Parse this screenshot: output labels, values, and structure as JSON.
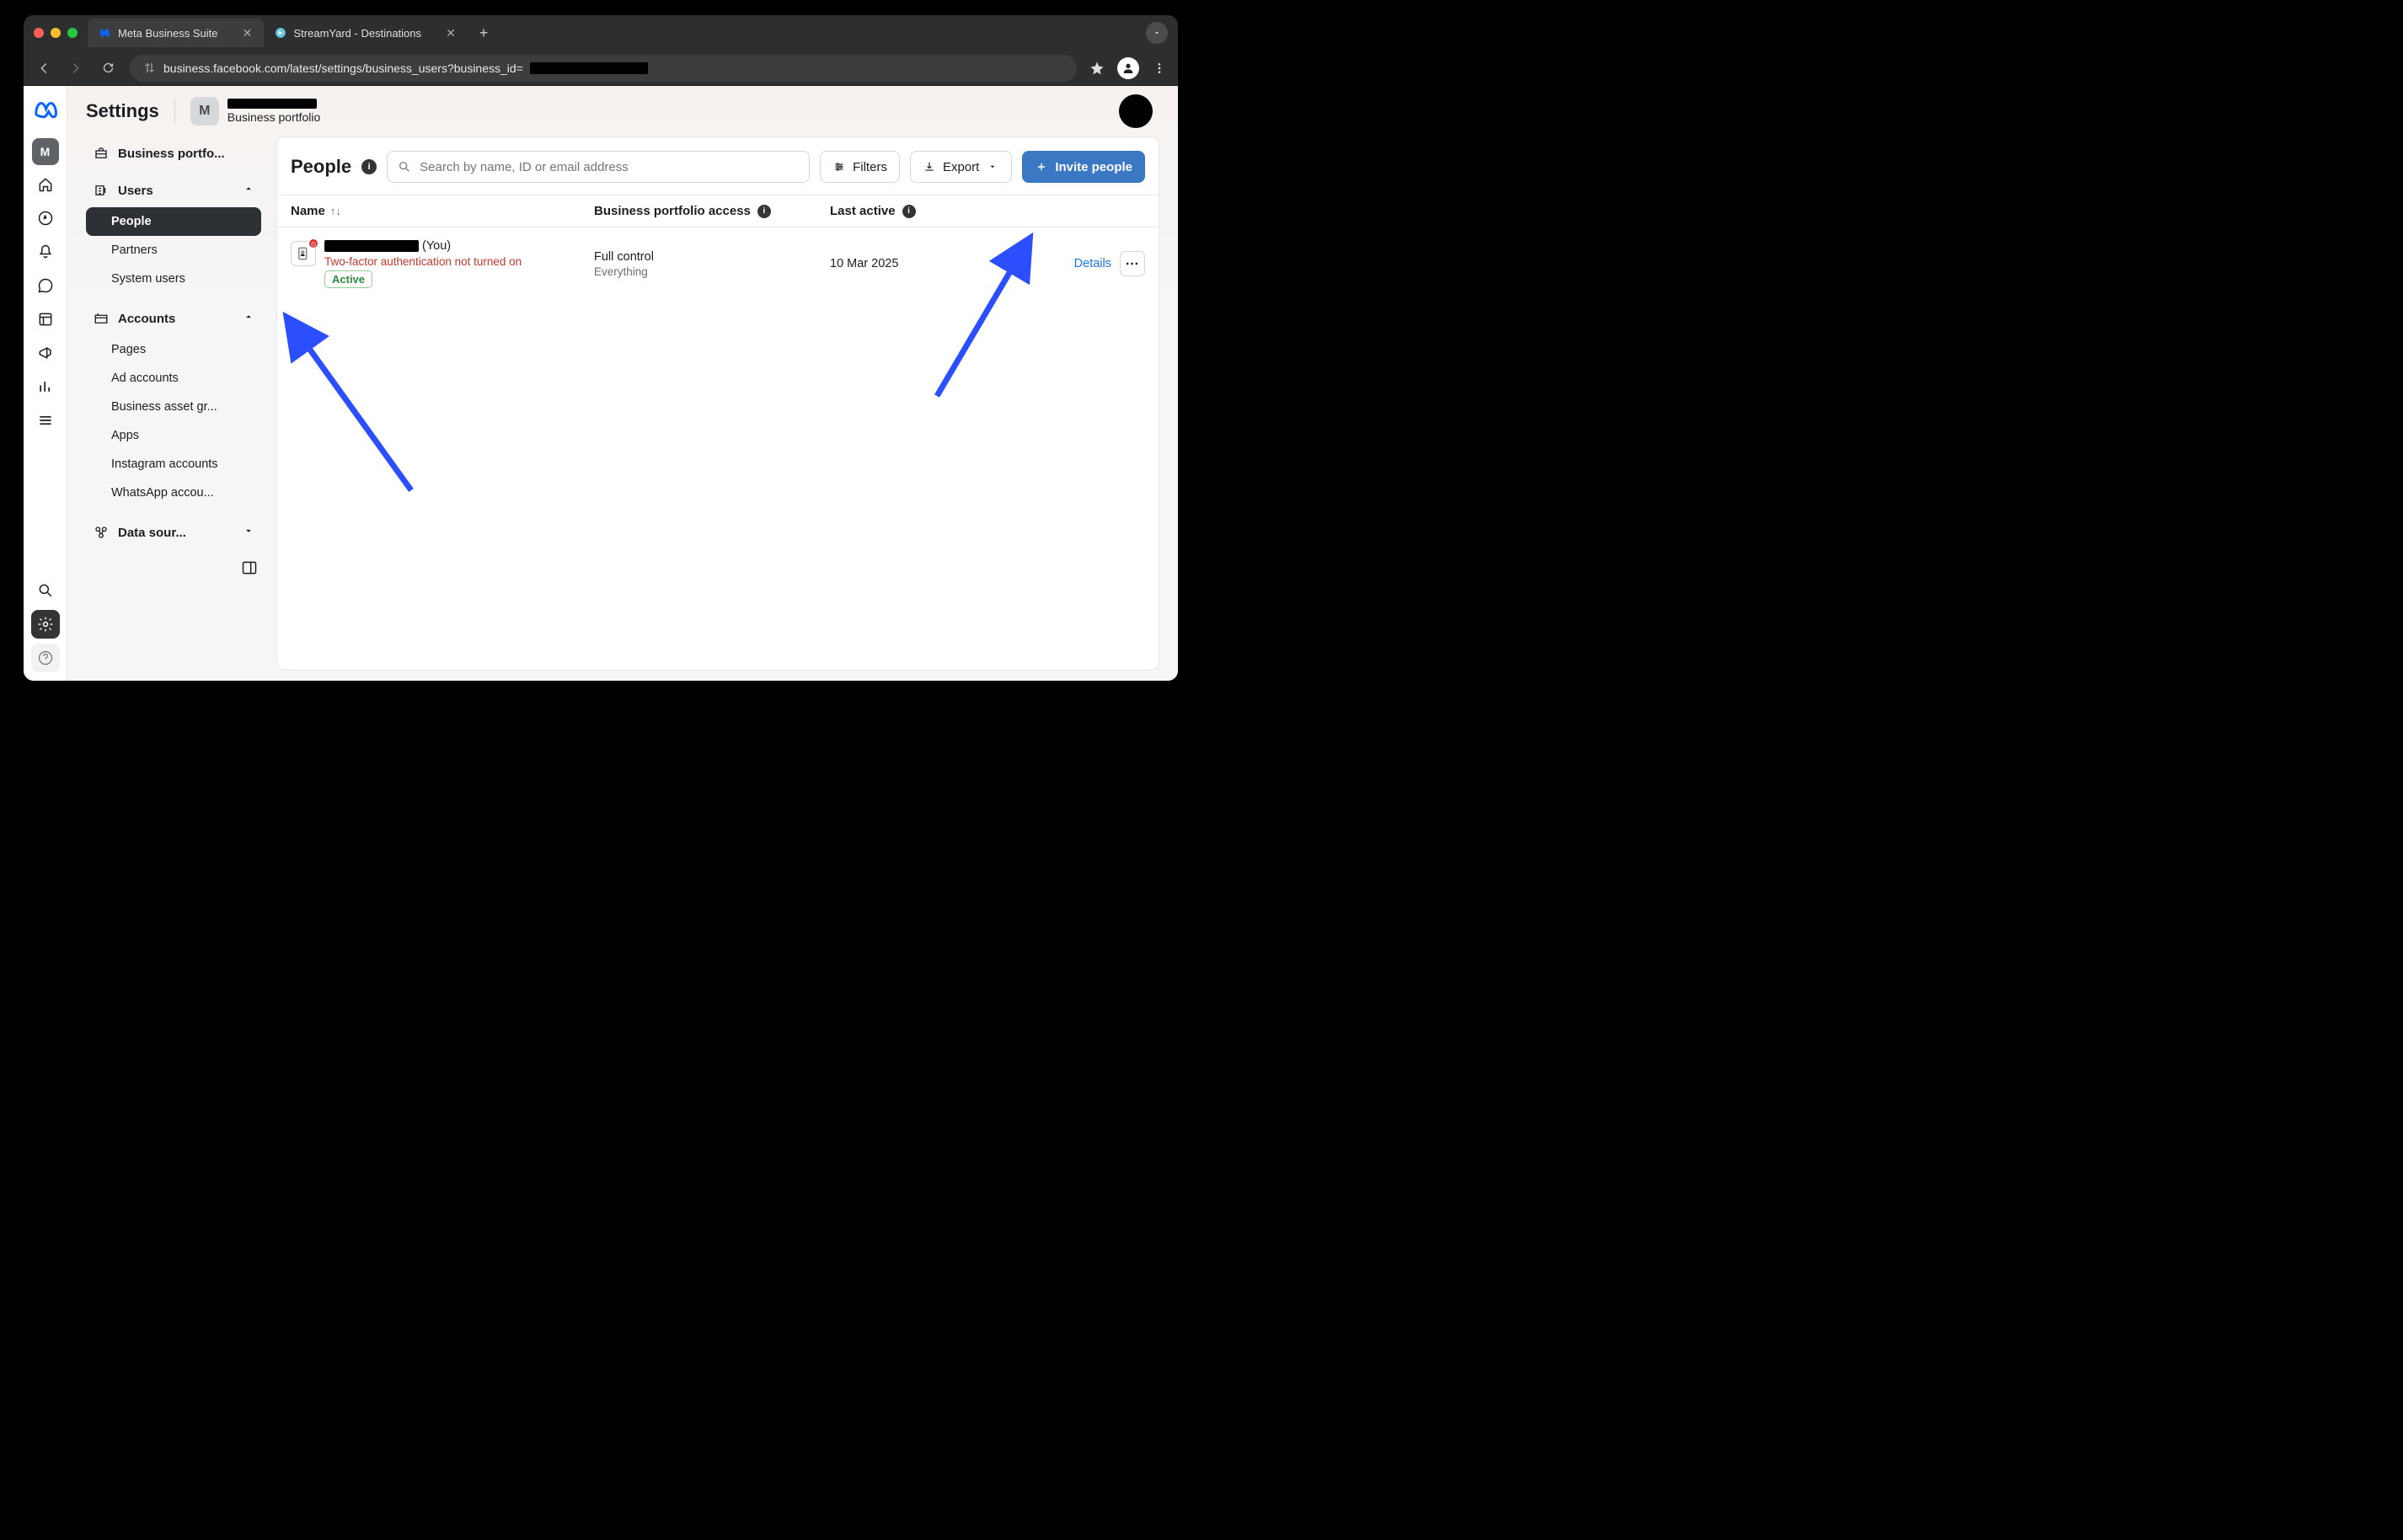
{
  "browser": {
    "tabs": [
      {
        "label": "Meta Business Suite",
        "active": true
      },
      {
        "label": "StreamYard - Destinations",
        "active": false
      }
    ],
    "url": "business.facebook.com/latest/settings/business_users?business_id="
  },
  "rail": {
    "chip": "M"
  },
  "header": {
    "title": "Settings",
    "portfolio_chip": "M",
    "portfolio_sub": "Business portfolio"
  },
  "sidebar": {
    "portfolio": "Business portfo...",
    "users": {
      "label": "Users",
      "items": [
        "People",
        "Partners",
        "System users"
      ],
      "active": 0
    },
    "accounts": {
      "label": "Accounts",
      "items": [
        "Pages",
        "Ad accounts",
        "Business asset gr...",
        "Apps",
        "Instagram accounts",
        "WhatsApp accou..."
      ]
    },
    "data_sources": "Data sour..."
  },
  "card": {
    "title": "People",
    "search_placeholder": "Search by name, ID or email address",
    "filters": "Filters",
    "export": "Export",
    "invite": "Invite people",
    "columns": {
      "name": "Name",
      "access": "Business portfolio access",
      "last": "Last active"
    },
    "row": {
      "you_suffix": "(You)",
      "warning": "Two-factor authentication not turned on",
      "status": "Active",
      "access": "Full control",
      "access_sub": "Everything",
      "last": "10 Mar 2025",
      "details": "Details"
    }
  }
}
